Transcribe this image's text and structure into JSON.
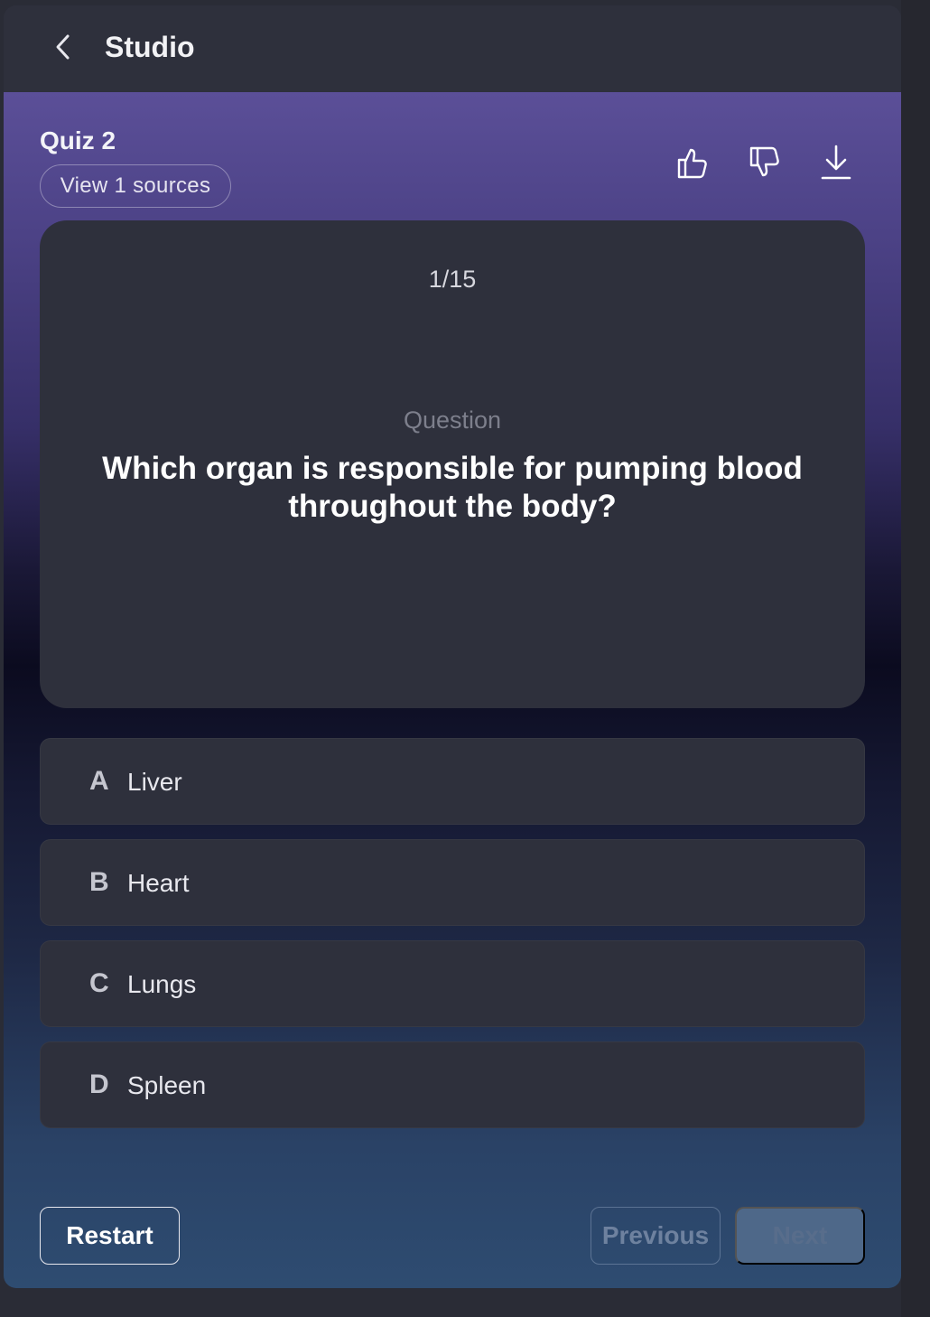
{
  "header": {
    "title": "Studio",
    "back_icon": "chevron-left-icon"
  },
  "quiz": {
    "title": "Quiz 2",
    "sources_label": "View 1 sources",
    "actions": [
      "thumbs-up-icon",
      "thumbs-down-icon",
      "download-icon"
    ],
    "counter": "1/15",
    "question_label": "Question",
    "question_text": "Which organ is responsible for pumping blood throughout the body?",
    "options": [
      {
        "letter": "A",
        "text": "Liver"
      },
      {
        "letter": "B",
        "text": "Heart"
      },
      {
        "letter": "C",
        "text": "Lungs"
      },
      {
        "letter": "D",
        "text": "Spleen"
      }
    ]
  },
  "footer": {
    "restart_label": "Restart",
    "previous_label": "Previous",
    "next_label": "Next"
  },
  "colors": {
    "panel": "#2e303c",
    "gradient_top": "#5b4f98",
    "gradient_mid": "#0b0b1f",
    "gradient_bottom": "#2e4c71"
  }
}
